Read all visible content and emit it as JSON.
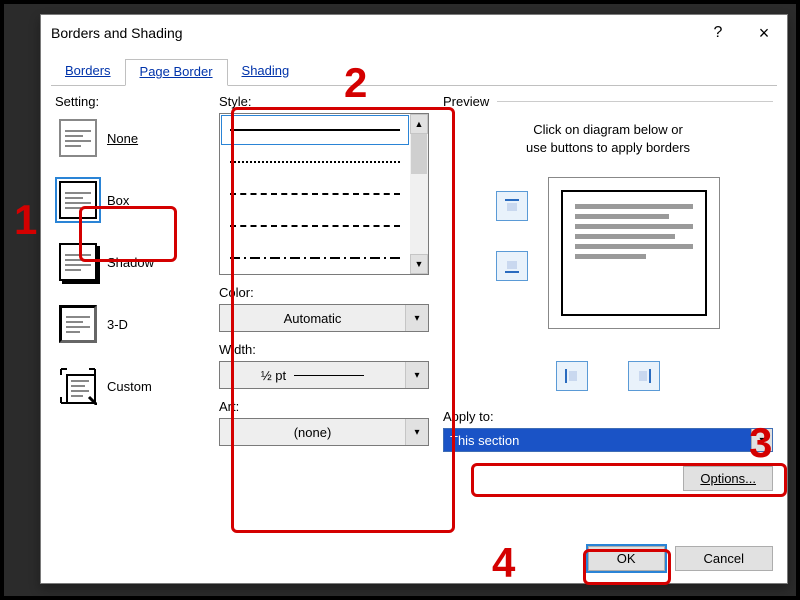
{
  "window": {
    "title": "Borders and Shading",
    "help": "?",
    "close": "×"
  },
  "tabs": {
    "borders": "Borders",
    "page_border": "Page Border",
    "shading": "Shading"
  },
  "setting": {
    "label": "Setting:",
    "none": "None",
    "box": "Box",
    "shadow": "Shadow",
    "d3": "3-D",
    "custom": "Custom"
  },
  "style": {
    "label": "Style:"
  },
  "color": {
    "label": "Color:",
    "value": "Automatic"
  },
  "width": {
    "label": "Width:",
    "value": "½ pt"
  },
  "art": {
    "label": "Art:",
    "value": "(none)"
  },
  "preview": {
    "label": "Preview",
    "hint1": "Click on diagram below or",
    "hint2": "use buttons to apply borders"
  },
  "apply": {
    "label": "Apply to:",
    "value": "This section"
  },
  "options": {
    "label": "Options..."
  },
  "footer": {
    "ok": "OK",
    "cancel": "Cancel"
  },
  "annotations": {
    "n1": "1",
    "n2": "2",
    "n3": "3",
    "n4": "4"
  }
}
